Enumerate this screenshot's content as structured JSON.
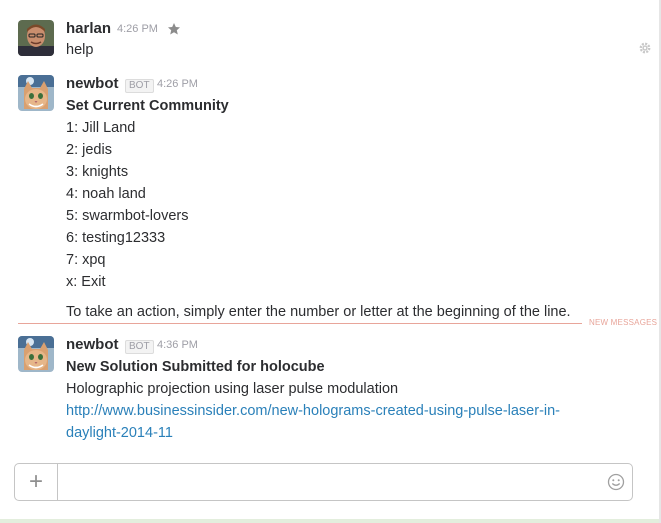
{
  "messages": [
    {
      "sender": "harlan",
      "time": "4:26 PM",
      "lines": [
        "help"
      ]
    },
    {
      "sender": "newbot",
      "bot_label": "BOT",
      "time": "4:26 PM",
      "title": "Set Current Community",
      "lines": [
        "1: Jill Land",
        "2: jedis",
        "3: knights",
        "4: noah land",
        "5: swarmbot-lovers",
        "6: testing12333",
        "7: xpq",
        "x: Exit"
      ],
      "footer": "To take an action, simply enter the number or letter at the beginning of the line."
    },
    {
      "sender": "newbot",
      "bot_label": "BOT",
      "time": "4:36 PM",
      "title": "New Solution Submitted for holocube",
      "text": "Holographic projection using laser pulse modulation",
      "link_line1": "http://www.businessinsider.com/new-holograms-created-using-pulse-laser-in-",
      "link_line2": "daylight-2014-11"
    }
  ],
  "divider_label": "NEW MESSAGES",
  "composer": {
    "plus": "+",
    "placeholder": ""
  },
  "icons": {
    "star": "star-icon",
    "gear": "gear-icon",
    "emoji": "smiley-icon"
  },
  "colors": {
    "link": "#2a80b9",
    "new_messages": "#e8a59a",
    "timestamp": "#9e9ea6"
  }
}
